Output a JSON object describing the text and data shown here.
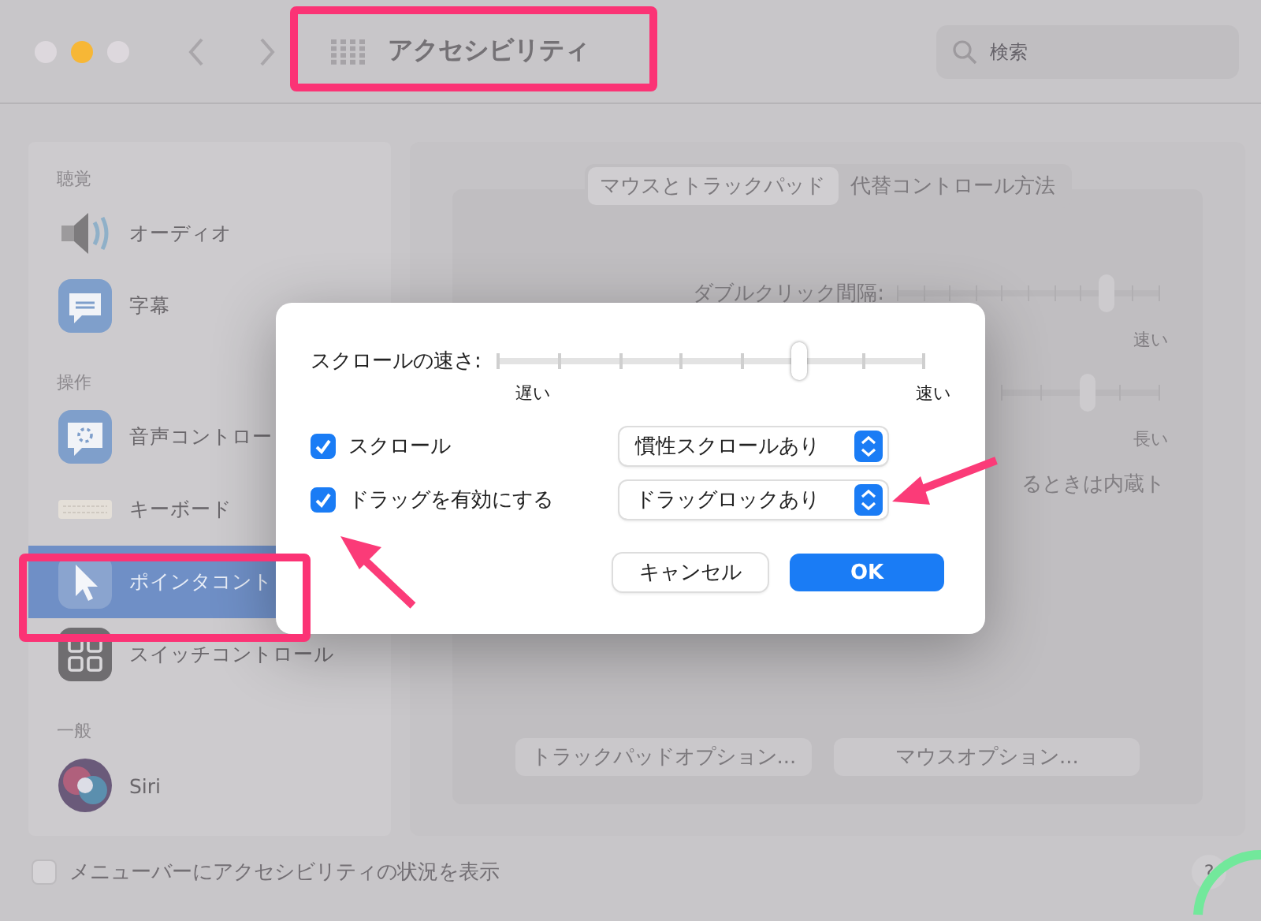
{
  "window": {
    "title": "アクセシビリティ",
    "search": {
      "placeholder": "検索"
    }
  },
  "sidebar": {
    "sections": [
      {
        "heading": "聴覚",
        "items": [
          {
            "label": "オーディオ",
            "selected": false
          },
          {
            "label": "字幕",
            "selected": false
          }
        ]
      },
      {
        "heading": "操作",
        "items": [
          {
            "label": "音声コントロー",
            "selected": false
          },
          {
            "label": "キーボード",
            "selected": false
          },
          {
            "label": "ポインタコント",
            "selected": true
          },
          {
            "label": "スイッチコントロール",
            "selected": false
          }
        ]
      },
      {
        "heading": "一般",
        "items": [
          {
            "label": "Siri",
            "selected": false
          }
        ]
      }
    ]
  },
  "main": {
    "tabs": [
      {
        "label": "マウスとトラックパッド",
        "selected": true
      },
      {
        "label": "代替コントロール方法",
        "selected": false
      }
    ],
    "double_click": {
      "label": "ダブルクリック間隔:",
      "level": 0.8,
      "max_label": "速い"
    },
    "second_slider": {
      "level": 0.55,
      "max_label": "長い"
    },
    "partial_text": "るときは内蔵ト",
    "buttons": [
      "トラックパッドオプション...",
      "マウスオプション..."
    ]
  },
  "dialog": {
    "speed": {
      "label": "スクロールの速さ:",
      "level": 0.71,
      "min_label": "遅い",
      "max_label": "速い"
    },
    "options": [
      {
        "label": "スクロール",
        "checked": true,
        "popup": "慣性スクロールあり"
      },
      {
        "label": "ドラッグを有効にする",
        "checked": true,
        "popup": "ドラッグロックあり"
      }
    ],
    "buttons": [
      {
        "label": "キャンセル",
        "kind": "secondary"
      },
      {
        "label": "OK",
        "kind": "primary"
      }
    ]
  },
  "footer": {
    "label": "メニューバーにアクセシビリティの状況を表示",
    "checked": false,
    "help": "?"
  }
}
